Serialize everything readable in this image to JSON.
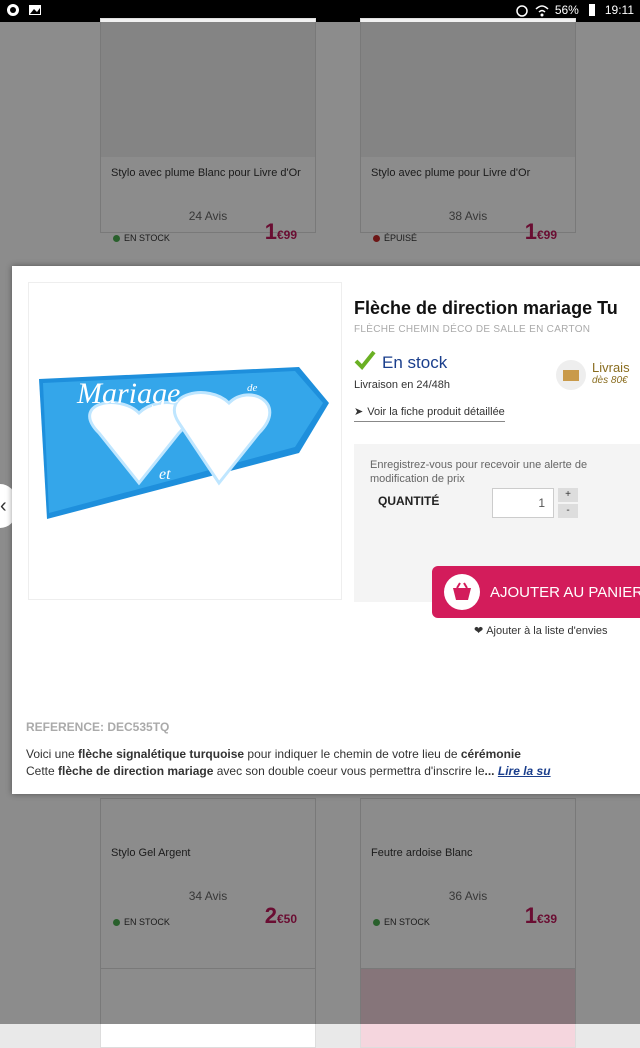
{
  "status": {
    "battery": "56%",
    "time": "19:11"
  },
  "cards": [
    {
      "name": "Stylo avec plume Blanc pour Livre d'Or",
      "reviews": "24 Avis",
      "stock": "EN STOCK",
      "stock_color": "#4caf50",
      "price_int": "1",
      "price_dec": "99"
    },
    {
      "name": "Stylo avec plume pour Livre d'Or",
      "reviews": "38 Avis",
      "stock": "ÉPUISÉ",
      "stock_color": "#c62828",
      "price_int": "1",
      "price_dec": "99"
    },
    {
      "name": "Stylo Gel Argent",
      "reviews": "34 Avis",
      "stock": "EN STOCK",
      "stock_color": "#4caf50",
      "price_int": "2",
      "price_dec": "50"
    },
    {
      "name": "Feutre ardoise Blanc",
      "reviews": "36 Avis",
      "stock": "EN STOCK",
      "stock_color": "#4caf50",
      "price_int": "1",
      "price_dec": "39"
    }
  ],
  "modal": {
    "title": "Flèche de direction mariage Tu",
    "subtitle": "FLÈCHE CHEMIN DÉCO DE SALLE EN CARTON",
    "instock": "En stock",
    "livraison": "Livraison en 24/48h",
    "detail_link": "Voir la fiche produit détaillée",
    "free_ship_title": "Livrais",
    "free_ship_sub": "dès 80€",
    "alert_text": "Enregistrez-vous pour recevoir une alerte de modification de prix",
    "qty_label": "QUANTITÉ",
    "qty_value": "1",
    "cart_button": "AJOUTER AU PANIER",
    "wishlist": "Ajouter à la liste d'envies",
    "reference": "REFERENCE: DEC535TQ",
    "desc_line1_a": "Voici une ",
    "desc_line1_b": "flèche signalétique turquoise",
    "desc_line1_c": " pour indiquer le chemin de votre lieu de ",
    "desc_line1_d": "cérémonie",
    "desc_line2_a": "Cette ",
    "desc_line2_b": "flèche de direction mariage",
    "desc_line2_c": " avec son double coeur vous permettra d'inscrire le",
    "desc_line2_d": "...",
    "read_more": "Lire la su",
    "image_text_main": "Mariage",
    "image_text_de": "de",
    "image_text_et": "et"
  },
  "colors": {
    "accent": "#d31c5b",
    "stock_blue": "#1a3e8c"
  }
}
